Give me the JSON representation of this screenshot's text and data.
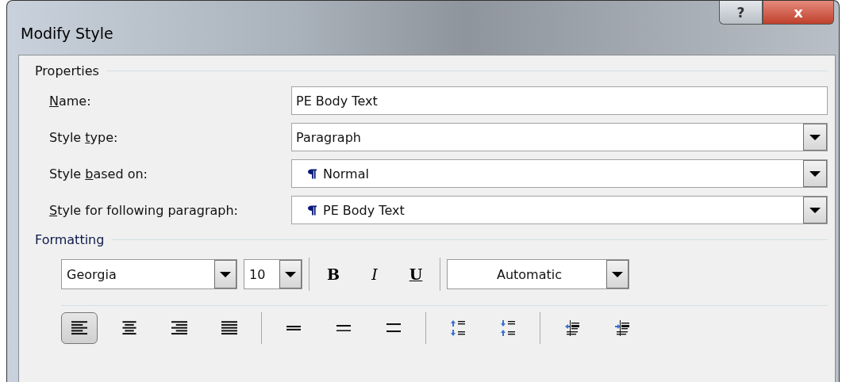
{
  "window": {
    "title": "Modify Style",
    "help_button": "?",
    "close_button": "x"
  },
  "properties": {
    "heading": "Properties",
    "rows": [
      {
        "kind": "text",
        "label": {
          "key": "N",
          "after": "ame:"
        },
        "value": "PE Body Text",
        "paragraph_mark": false
      },
      {
        "kind": "dropdown",
        "label": {
          "before": "Style ",
          "key": "t",
          "after": "ype:"
        },
        "value": "Paragraph",
        "paragraph_mark": false
      },
      {
        "kind": "dropdown",
        "label": {
          "before": "Style ",
          "key": "b",
          "after": "ased on:"
        },
        "value": "Normal",
        "paragraph_mark": true
      },
      {
        "kind": "dropdown",
        "label": {
          "key": "S",
          "after": "tyle for following paragraph:"
        },
        "value": "PE Body Text",
        "paragraph_mark": true
      }
    ]
  },
  "formatting": {
    "heading": "Formatting",
    "font": "Georgia",
    "size": "10",
    "bold": "B",
    "italic": "I",
    "underline": "U",
    "font_color": "Automatic",
    "alignment": [
      {
        "kind": "left",
        "selected": true
      },
      {
        "kind": "center",
        "selected": false
      },
      {
        "kind": "right",
        "selected": false
      },
      {
        "kind": "justify",
        "selected": false
      }
    ],
    "spacing": [
      {
        "kind": "single",
        "selected": false
      },
      {
        "kind": "onehalf",
        "selected": false
      },
      {
        "kind": "double",
        "selected": false
      }
    ],
    "paragraph_spacing": [
      {
        "kind": "increase"
      },
      {
        "kind": "decrease"
      }
    ],
    "indent": [
      {
        "kind": "decrease"
      },
      {
        "kind": "increase"
      }
    ]
  }
}
